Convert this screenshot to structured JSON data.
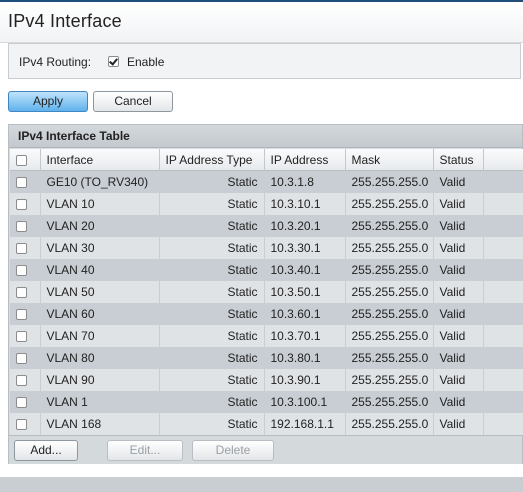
{
  "page": {
    "title": "IPv4 Interface"
  },
  "routing": {
    "label": "IPv4 Routing:",
    "enable_label": "Enable",
    "enabled": true
  },
  "actions": {
    "apply": "Apply",
    "cancel": "Cancel"
  },
  "table": {
    "caption": "IPv4 Interface Table",
    "columns": [
      "Interface",
      "IP Address Type",
      "IP Address",
      "Mask",
      "Status"
    ],
    "rows": [
      [
        "GE10 (TO_RV340)",
        "Static",
        "10.3.1.8",
        "255.255.255.0",
        "Valid"
      ],
      [
        "VLAN 10",
        "Static",
        "10.3.10.1",
        "255.255.255.0",
        "Valid"
      ],
      [
        "VLAN 20",
        "Static",
        "10.3.20.1",
        "255.255.255.0",
        "Valid"
      ],
      [
        "VLAN 30",
        "Static",
        "10.3.30.1",
        "255.255.255.0",
        "Valid"
      ],
      [
        "VLAN 40",
        "Static",
        "10.3.40.1",
        "255.255.255.0",
        "Valid"
      ],
      [
        "VLAN 50",
        "Static",
        "10.3.50.1",
        "255.255.255.0",
        "Valid"
      ],
      [
        "VLAN 60",
        "Static",
        "10.3.60.1",
        "255.255.255.0",
        "Valid"
      ],
      [
        "VLAN 70",
        "Static",
        "10.3.70.1",
        "255.255.255.0",
        "Valid"
      ],
      [
        "VLAN 80",
        "Static",
        "10.3.80.1",
        "255.255.255.0",
        "Valid"
      ],
      [
        "VLAN 90",
        "Static",
        "10.3.90.1",
        "255.255.255.0",
        "Valid"
      ],
      [
        "VLAN 1",
        "Static",
        "10.3.100.1",
        "255.255.255.0",
        "Valid"
      ],
      [
        "VLAN 168",
        "Static",
        "192.168.1.1",
        "255.255.255.0",
        "Valid"
      ]
    ],
    "footer": {
      "add": "Add...",
      "edit": "Edit...",
      "delete": "Delete"
    }
  },
  "colors": {
    "apply_button": "#5fb2ec",
    "row_odd": "#c8ced3",
    "row_even": "#dfe3e6",
    "top_line": "#1f4f7a"
  },
  "icons": {
    "row_select": "checkbox-icon",
    "routing_enable": "checkbox-checked-icon"
  }
}
